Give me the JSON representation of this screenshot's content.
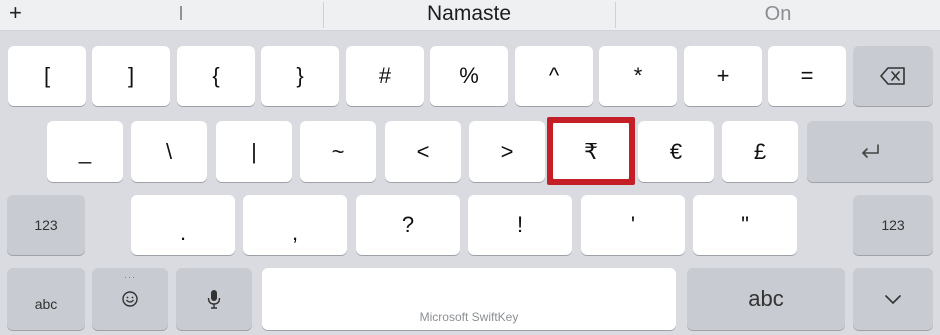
{
  "suggestion_bar": {
    "plus": "+",
    "left": "I",
    "middle": "Namaste",
    "right": "On"
  },
  "rows": {
    "row1": [
      "[",
      "]",
      "{",
      "}",
      "#",
      "%",
      "^",
      "*",
      "+",
      "="
    ],
    "row2": [
      "_",
      "\\",
      "|",
      "~",
      "<",
      ">",
      "₹",
      "€",
      "£"
    ],
    "row3": [
      ".",
      ",",
      "?",
      "!",
      "'",
      "\""
    ]
  },
  "fn_keys": {
    "numbers_left": "123",
    "numbers_right": "123",
    "abc_small": "abc",
    "abc_large": "abc",
    "space_brand": "Microsoft SwiftKey",
    "emoji_dots": "···"
  },
  "icons": {
    "backspace": "backspace-icon",
    "enter": "enter-icon",
    "emoji": "emoji-icon",
    "mic": "microphone-icon",
    "hide": "chevron-down-icon"
  },
  "colors": {
    "background": "#d9dbe0",
    "key": "#ffffff",
    "function_key": "#c8cbd1",
    "highlight": "#c41f26"
  }
}
